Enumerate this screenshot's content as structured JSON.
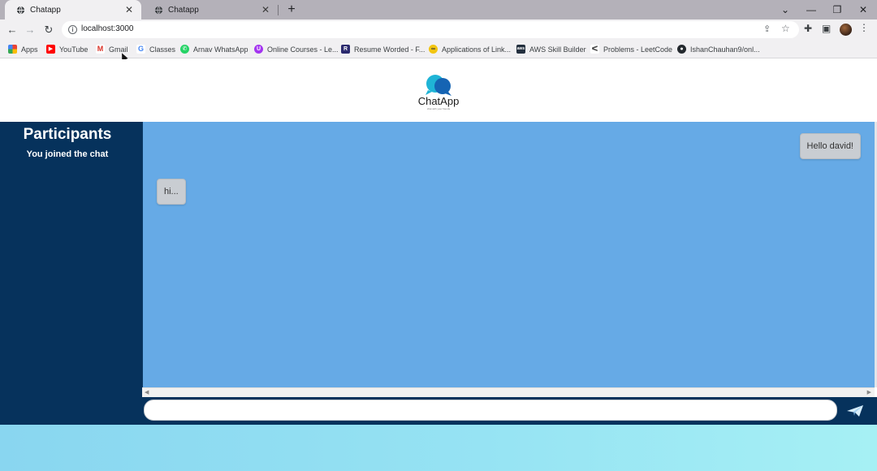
{
  "browser": {
    "tabs": [
      {
        "title": "Chatapp",
        "active": true
      },
      {
        "title": "Chatapp",
        "active": false
      }
    ],
    "url": "localhost:3000",
    "bookmarks": [
      {
        "label": "Apps",
        "icon": "apps-grid-icon",
        "color": "#e8453c"
      },
      {
        "label": "YouTube",
        "icon": "youtube-icon",
        "color": "#ff0000"
      },
      {
        "label": "Gmail",
        "icon": "gmail-icon",
        "color": "#d93025"
      },
      {
        "label": "Classes",
        "icon": "google-icon",
        "color": "#4285f4"
      },
      {
        "label": "Arnav WhatsApp",
        "icon": "whatsapp-icon",
        "color": "#25d366"
      },
      {
        "label": "Online Courses - Le...",
        "icon": "udemy-icon",
        "color": "#a435f0"
      },
      {
        "label": "Resume Worded - F...",
        "icon": "resume-worded-icon",
        "color": "#2b2a6e"
      },
      {
        "label": "Applications of Link...",
        "icon": "link-app-icon",
        "color": "#f2c511"
      },
      {
        "label": "AWS Skill Builder",
        "icon": "aws-icon",
        "color": "#232f3e"
      },
      {
        "label": "Problems - LeetCode",
        "icon": "leetcode-icon",
        "color": "#444444"
      },
      {
        "label": "IshanChauhan9/onl...",
        "icon": "github-icon",
        "color": "#24292e"
      }
    ]
  },
  "app": {
    "logo_text": "ChatApp",
    "logo_tagline": "chat with your friends"
  },
  "sidebar": {
    "title": "Participants",
    "note": "You joined the chat"
  },
  "messages": [
    {
      "text": "Hello david!",
      "side": "right"
    },
    {
      "text": "hi...",
      "side": "left"
    }
  ],
  "composer": {
    "value": "",
    "placeholder": ""
  },
  "colors": {
    "sidebar_bg": "#06325c",
    "chat_bg": "#66aae6",
    "bubble_bg": "#c9cdd2",
    "accent": "#2f7fd6"
  }
}
